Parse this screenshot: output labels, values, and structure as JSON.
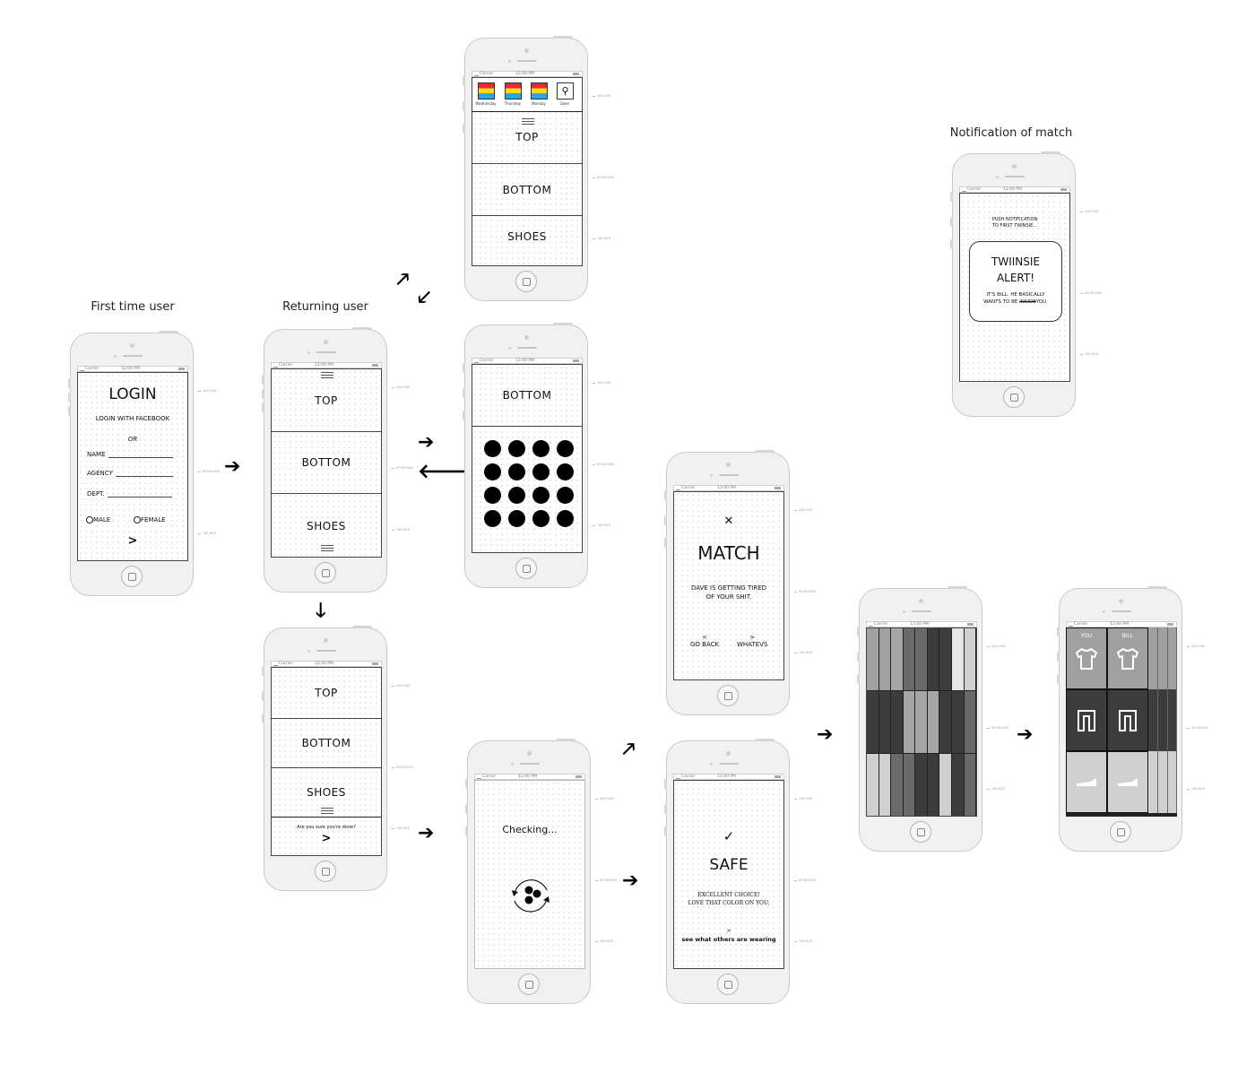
{
  "labels": {
    "first_time": "First time user",
    "returning": "Returning user",
    "notification": "Notification of match"
  },
  "status_bar": {
    "carrier": "Carrier",
    "time": "12:00 PM"
  },
  "annotations": {
    "nav": "NAV BAR",
    "keyboard": "KEYBOARD",
    "tab": "TAB BAR"
  },
  "arrows": {
    "right": "➔",
    "left": "🡐",
    "down": "🡓",
    "up_right": "🡕",
    "down_left": "🡗"
  },
  "login": {
    "title": "LOGIN",
    "facebook": "LOGIN WITH FACEBOOK",
    "or": "OR",
    "fields": [
      "NAME",
      "AGENCY",
      "DEPT."
    ],
    "genders": [
      "MALE",
      "FEMALE"
    ],
    "next": ">"
  },
  "returning": {
    "sections": [
      "TOP",
      "BOTTOM",
      "SHOES"
    ]
  },
  "history": {
    "days": [
      "Wednesday",
      "Thursday",
      "Monday"
    ],
    "save_label": "Save",
    "sections": [
      "TOP",
      "BOTTOM",
      "SHOES"
    ]
  },
  "picker": {
    "title": "BOTTOM",
    "swatch_count": 16
  },
  "confirm": {
    "sections": [
      "TOP",
      "BOTTOM",
      "SHOES"
    ],
    "question": "Are you sure you're done?",
    "next": ">"
  },
  "checking": {
    "text": "Checking..."
  },
  "match": {
    "icon": "✕",
    "title": "MATCH",
    "message_line1": "DAVE IS GETTING TIRED",
    "message_line2": "OF YOUR SHIT.",
    "back_chevron": "<",
    "back_label": "GO BACK",
    "forward_chevron": ">",
    "forward_label": "WHATEVS"
  },
  "safe": {
    "icon": "✓",
    "title": "SAFE",
    "message_line1": "EXCELLENT CHOICE!",
    "message_line2": "LOVE THAT COLOR ON YOU.",
    "chevron": ">",
    "link": "see what others are wearing"
  },
  "grid": {
    "rows": [
      [
        "#a0a0a0",
        "#a0a0a0",
        "#a6a6a6",
        "#6a6a6a",
        "#6a6a6a",
        "#3c3c3c",
        "#3c3c3c",
        "#e6e6e6",
        "#d0d0d0"
      ],
      [
        "#3c3c3c",
        "#3c3c3c",
        "#3c3c3c",
        "#a6a6a6",
        "#a6a6a6",
        "#a6a6a6",
        "#3c3c3c",
        "#3c3c3c",
        "#6a6a6a"
      ],
      [
        "#d0d0d0",
        "#d0d0d0",
        "#6a6a6a",
        "#6a6a6a",
        "#3c3c3c",
        "#3c3c3c",
        "#d0d0d0",
        "#3c3c3c",
        "#6a6a6a"
      ]
    ]
  },
  "compare": {
    "people": [
      "YOU",
      "BILL"
    ],
    "row_colors": [
      "#a0a0a0",
      "#3c3c3c",
      "#d0d0d0"
    ]
  },
  "notification": {
    "push_line1": "PUSH NOTIFICATION",
    "push_line2": "TO FIRST TWINSIE...",
    "title_line1": "TWIINSIE",
    "title_line2": "ALERT!",
    "body_line1": "IT'S BILL. HE BASICALLY",
    "body_prefix": "WANTS TO BE ",
    "body_strike": "INSIDE",
    "body_suffix": "YOU."
  }
}
